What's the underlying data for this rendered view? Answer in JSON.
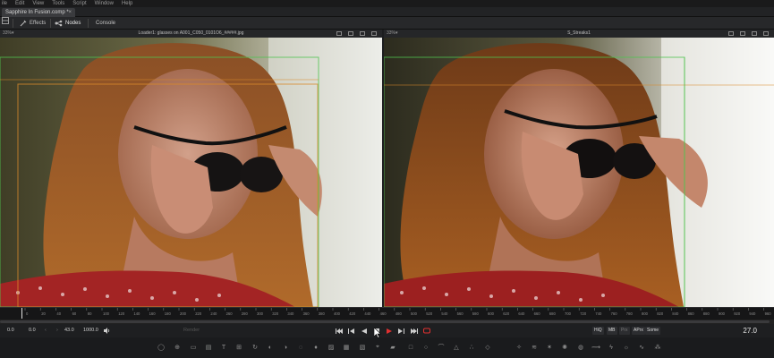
{
  "menu": {
    "items": [
      "ile",
      "Edit",
      "View",
      "Tools",
      "Script",
      "Window",
      "Help"
    ]
  },
  "tab": {
    "title": "Sapphire In Fusion.comp *",
    "close": "×"
  },
  "toolbar": {
    "effects_label": "Effects",
    "nodes_label": "Nodes",
    "console_label": "Console"
  },
  "viewer_left": {
    "zoom": "33%▾",
    "title": "Loader1: glasses on A001_C050_0101O6_#####.jpg"
  },
  "viewer_right": {
    "zoom": "33%▾",
    "title": "S_Streaks1"
  },
  "transport": {
    "global_start": "0.0",
    "render_start": "0.0",
    "render_end": "43.0",
    "global_end": "1000.0",
    "render_label": "Render",
    "quality": [
      "HiQ",
      "MB",
      "Prx",
      "APrx",
      "Some"
    ],
    "current_frame": "27.0"
  },
  "timeline": {
    "ticks": [
      "0",
      "20",
      "40",
      "60",
      "80",
      "100",
      "120",
      "140",
      "160",
      "180",
      "200",
      "220",
      "240",
      "260",
      "280",
      "300",
      "320",
      "340",
      "360",
      "380",
      "400",
      "420",
      "440",
      "460",
      "480",
      "500",
      "520",
      "540",
      "560",
      "580",
      "600",
      "620",
      "640",
      "660",
      "680",
      "700",
      "720",
      "740",
      "760",
      "780",
      "800",
      "820",
      "840",
      "860",
      "880",
      "900",
      "920",
      "940",
      "960",
      "980"
    ]
  },
  "colors": {
    "accent_red": "#e03030",
    "guide_green": "#4fc34f",
    "guide_orange": "#d88a2a"
  },
  "icons": [
    "volume-icon",
    "skip-start-icon",
    "step-back-icon",
    "play-reverse-icon",
    "stop-icon",
    "play-icon",
    "step-forward-icon",
    "skip-end-icon",
    "loop-icon"
  ]
}
